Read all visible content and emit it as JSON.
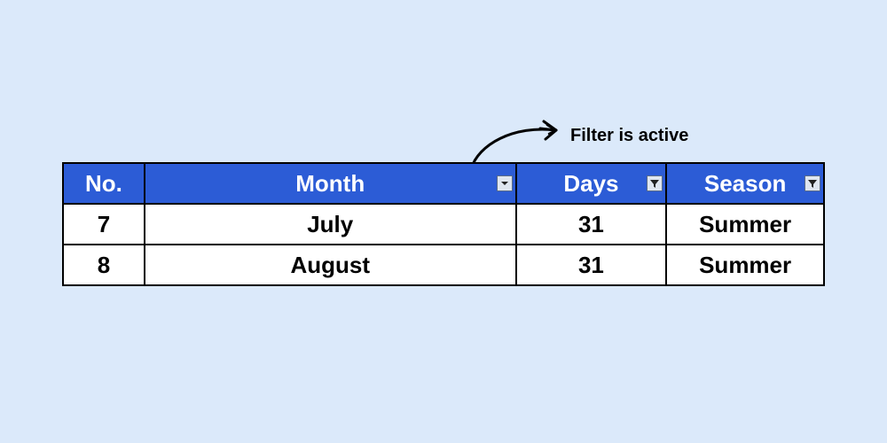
{
  "annotation": {
    "text": "Filter is active"
  },
  "table": {
    "headers": {
      "no": "No.",
      "month": "Month",
      "days": "Days",
      "season": "Season"
    },
    "rows": [
      {
        "no": "7",
        "month": "July",
        "days": "31",
        "season": "Summer"
      },
      {
        "no": "8",
        "month": "August",
        "days": "31",
        "season": "Summer"
      }
    ]
  }
}
